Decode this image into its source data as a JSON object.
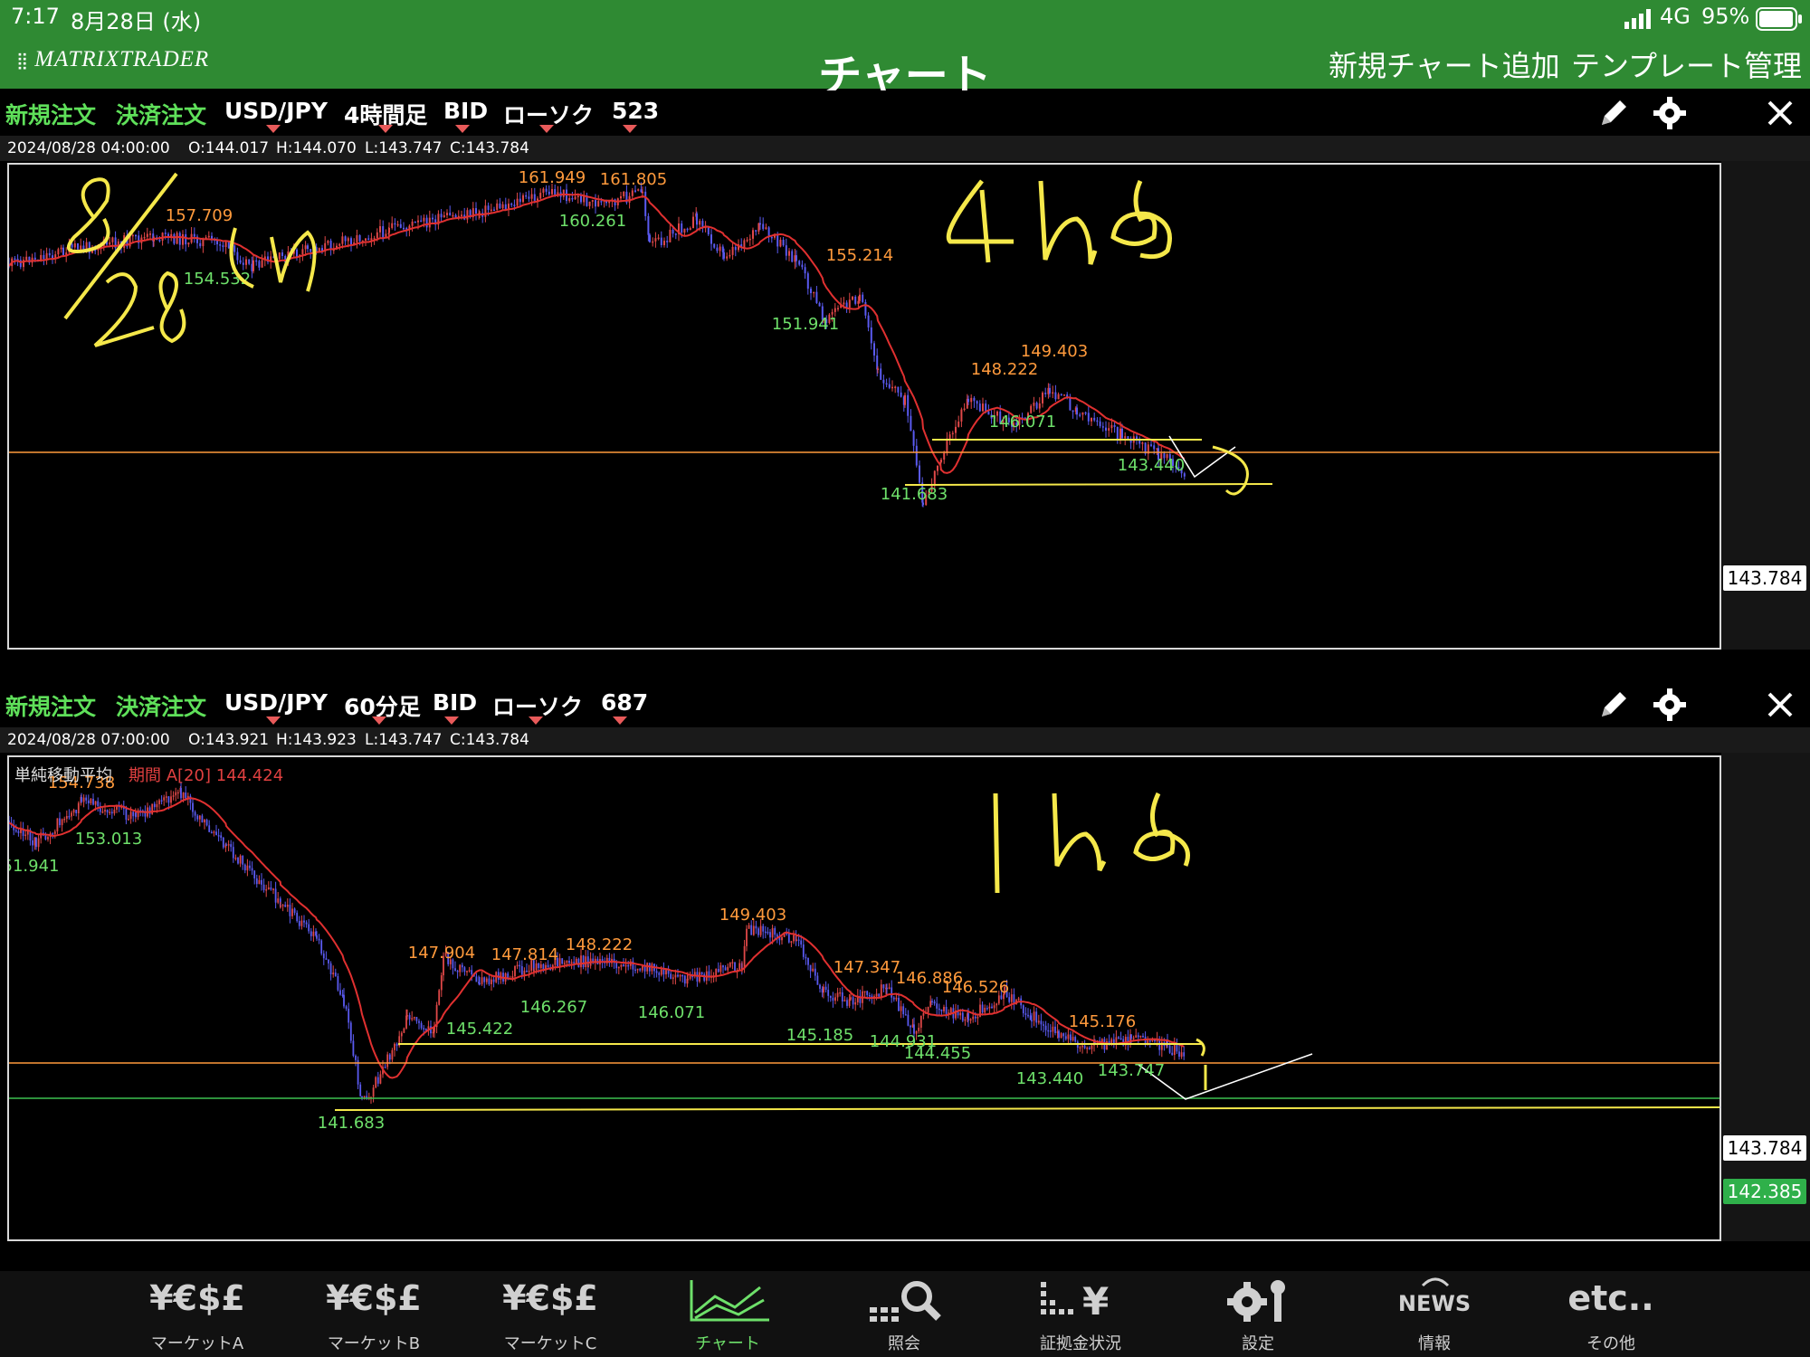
{
  "status_bar": {
    "time": "7:17",
    "date": "8月28日 (水)",
    "network": "4G",
    "battery": "95%"
  },
  "nav": {
    "logo": "MATRIXTRADER",
    "title": "チャート",
    "add_chart": "新規チャート追加",
    "template_manage": "テンプレート管理"
  },
  "chart1": {
    "new_order": "新規注文",
    "settle_order": "決済注文",
    "symbol": "USD/JPY",
    "timeframe": "4時間足",
    "price_type": "BID",
    "chart_style": "ローソク",
    "count": "523",
    "ohlc": {
      "datetime": "2024/08/28 04:00:00",
      "o": "O:144.017",
      "h": "H:144.070",
      "l": "L:143.747",
      "c": "C:143.784"
    },
    "current_price": "143.784",
    "high_labels": [
      "157.709",
      "161.949",
      "161.805",
      "155.214",
      "148.222",
      "149.403"
    ],
    "low_labels": [
      "154.532",
      "160.261",
      "151.941",
      "146.071",
      "143.440",
      "141.683"
    ],
    "handwriting": [
      "8/28",
      "4h足"
    ],
    "line_colors": {
      "price": "#ff9a3c",
      "ma": "#e03030",
      "drawing": "#f5e84a"
    }
  },
  "chart2": {
    "new_order": "新規注文",
    "settle_order": "決済注文",
    "symbol": "USD/JPY",
    "timeframe": "60分足",
    "price_type": "BID",
    "chart_style": "ローソク",
    "count": "687",
    "ohlc": {
      "datetime": "2024/08/28 07:00:00",
      "o": "O:143.921",
      "h": "H:143.923",
      "l": "L:143.747",
      "c": "C:143.784"
    },
    "indicator_name": "単純移動平均",
    "indicator_param": "期間 A[20] 144.424",
    "current_price": "143.784",
    "support_price": "142.385",
    "high_labels": [
      "154.738",
      "147.904",
      "147.814",
      "148.222",
      "149.403",
      "147.347",
      "146.886",
      "146.526",
      "145.176"
    ],
    "low_labels": [
      "51.941",
      "153.013",
      "145.422",
      "146.267",
      "146.071",
      "145.185",
      "144.931",
      "144.455",
      "143.440",
      "143.747",
      "141.683"
    ],
    "handwriting": [
      "1h足"
    ]
  },
  "tabs": [
    {
      "label": "マーケットA",
      "glyph": "¥€$£"
    },
    {
      "label": "マーケットB",
      "glyph": "¥€$£"
    },
    {
      "label": "マーケットC",
      "glyph": "¥€$£"
    },
    {
      "label": "チャート",
      "glyph": ""
    },
    {
      "label": "照会",
      "glyph": ""
    },
    {
      "label": "証拠金状況",
      "glyph": ""
    },
    {
      "label": "設定",
      "glyph": ""
    },
    {
      "label": "情報",
      "glyph": "NEWS"
    },
    {
      "label": "その他",
      "glyph": "etc.."
    }
  ]
}
